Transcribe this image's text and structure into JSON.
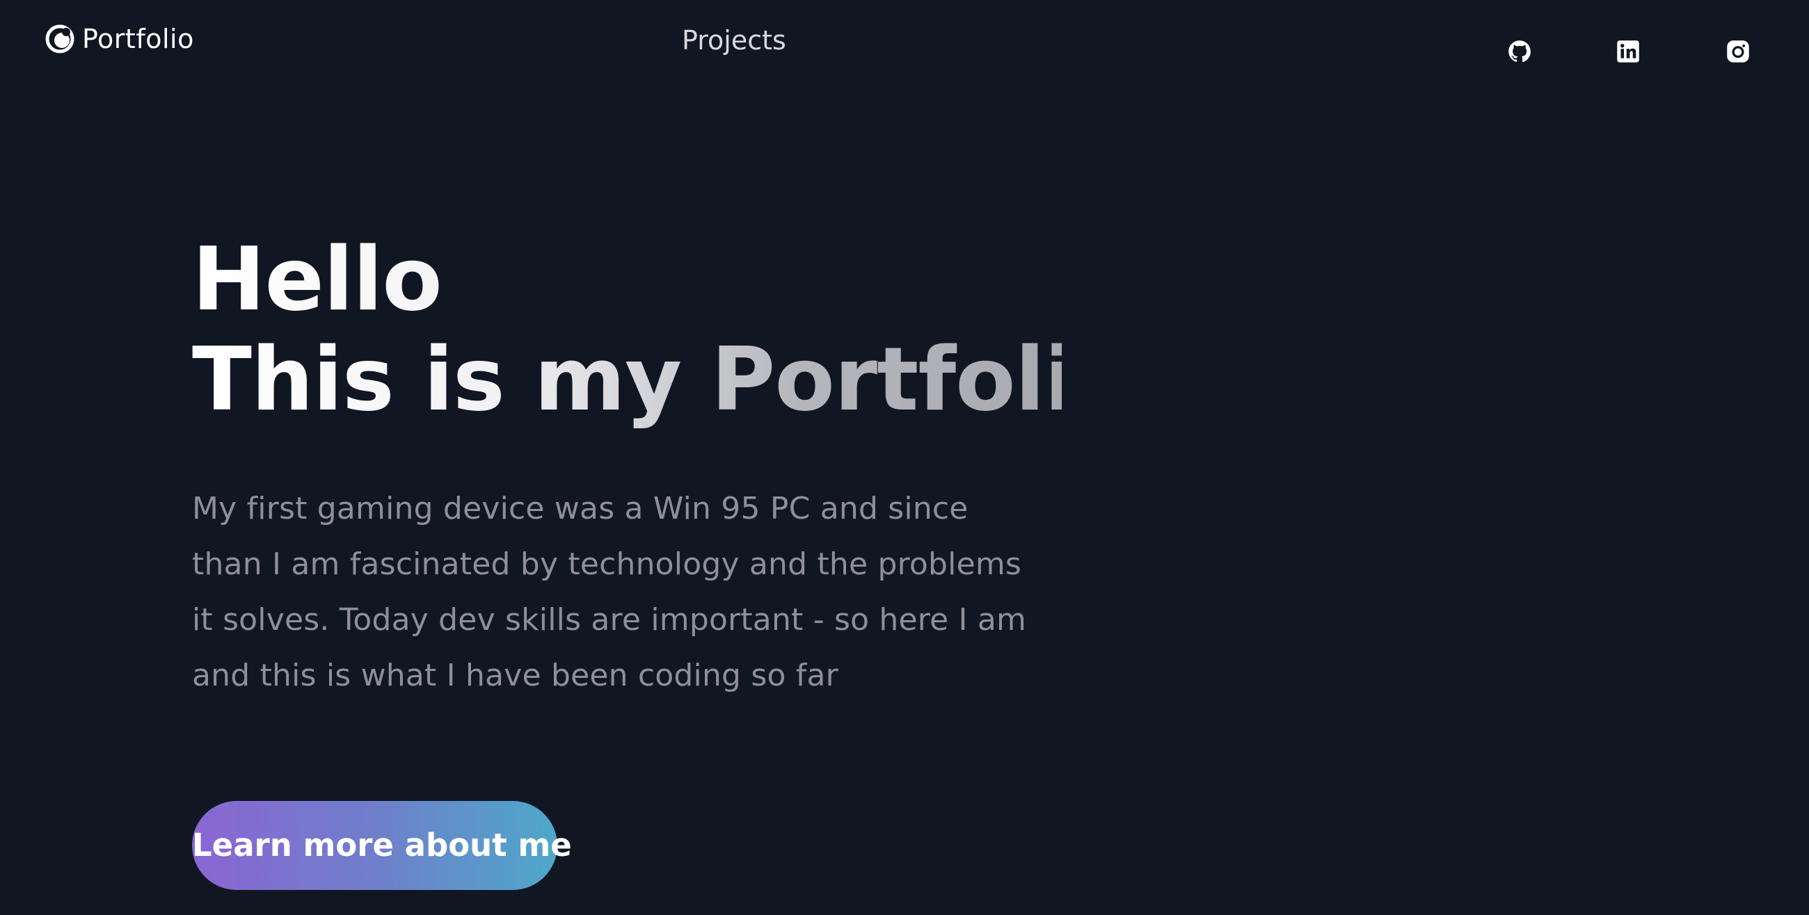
{
  "header": {
    "brand": {
      "icon": "portfolio-logo-icon",
      "label": "Portfolio"
    },
    "nav": [
      {
        "label": "Projects"
      }
    ],
    "social": [
      {
        "icon": "github-icon"
      },
      {
        "icon": "linkedin-icon"
      },
      {
        "icon": "instagram-icon"
      }
    ]
  },
  "hero": {
    "title_line1": "Hello",
    "title_line2": "This is my Portfolio",
    "description": "My first gaming device was a Win 95 PC and since than I am fascinated by technology and the problems it solves. Today dev skills are important - so here I am and this is what I have been coding so far",
    "cta_label": "Learn more about me"
  },
  "colors": {
    "background": "#111623",
    "text_primary": "#ffffff",
    "text_muted": "#8e8f98",
    "cta_gradient_start": "#8a66d3",
    "cta_gradient_end": "#4ea8c9"
  }
}
